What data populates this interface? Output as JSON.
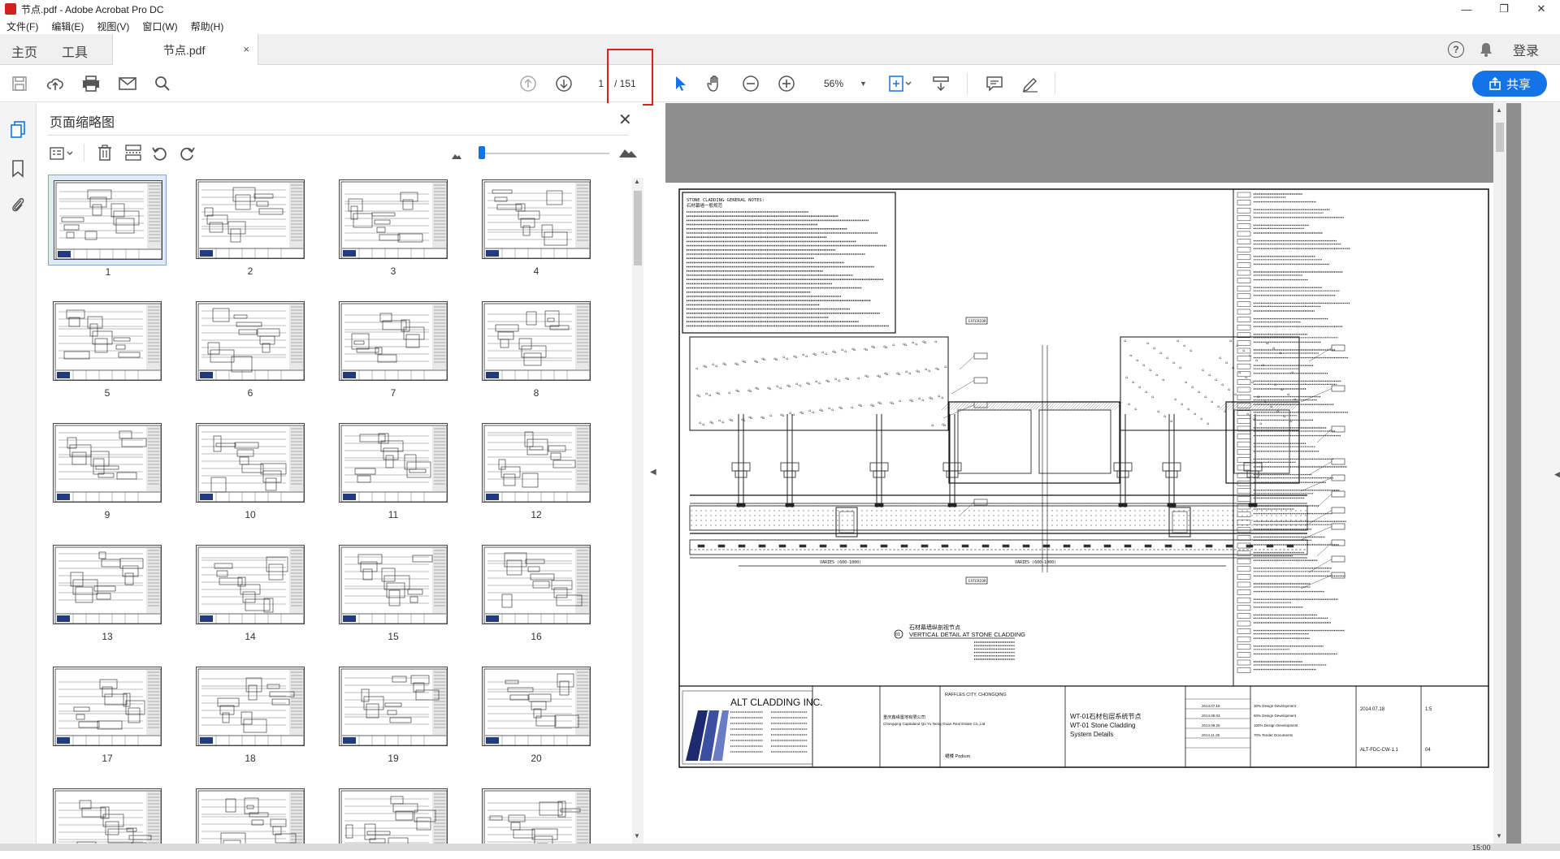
{
  "window": {
    "title": "节点.pdf - Adobe Acrobat Pro DC",
    "controls": {
      "minimize": "—",
      "restore": "❐",
      "close": "✕"
    }
  },
  "menu": [
    "文件(F)",
    "编辑(E)",
    "视图(V)",
    "窗口(W)",
    "帮助(H)"
  ],
  "tabs": {
    "home": "主页",
    "tools": "工具",
    "document": "节点.pdf",
    "close": "×",
    "login": "登录"
  },
  "toolbar": {
    "page_current": "1",
    "page_total": "/ 151",
    "zoom": "56%",
    "share": "共享"
  },
  "thumbnails_panel": {
    "title": "页面缩略图",
    "close": "✕",
    "pages": [
      "1",
      "2",
      "3",
      "4",
      "5",
      "6",
      "7",
      "8",
      "9",
      "10",
      "11",
      "12",
      "13",
      "14",
      "15",
      "16",
      "17",
      "18",
      "19",
      "20"
    ],
    "selected_page": "1"
  },
  "drawing": {
    "notes_heading": "STONE CLADDING GENERAL NOTES:",
    "notes_sub": "石材幕墙一般规范",
    "exterior_top": "EXTERIOR",
    "exterior_bottom": "EXTERIOR",
    "detail_cn": "石材幕墙纵剖视节点",
    "detail_en": "VERTICAL DETAIL AT STONE CLADDING",
    "detail_no": "01",
    "span_left": "VARIES (600-1000)",
    "span_right": "VARIES (600-1000)",
    "company": "ALT CLADDING INC.",
    "project_cn": "WT-01石材包层系统节点",
    "project_en": "WT-01 Stone Cladding",
    "project_en2": "System Details",
    "client_cn": "重庆鑫缘置地有限公司",
    "client_en": "Chongqing Capitaland Qu Yu Nong Guan Real Estate Co.,Ltd.",
    "date": "2014.07.18",
    "scale": "1:5",
    "sheet": "ALT-FDC-CW-1.1",
    "rev": "04",
    "location": "RAFFLES CITY, CHONGQING",
    "podium": "裙楼  Podium",
    "rev_list": [
      "2014.07.18",
      "2014.08.03",
      "2014.09.25",
      "2014.11.25"
    ],
    "rev_notes": [
      "30% Design Development",
      "60% Design Development",
      "100% Design Development",
      "70% Tender Documents"
    ]
  },
  "status": {
    "time": "15:00"
  },
  "colors": {
    "accent": "#1473e6",
    "highlight_box": "#e02020",
    "viewer_bg": "#8e8e8e"
  }
}
